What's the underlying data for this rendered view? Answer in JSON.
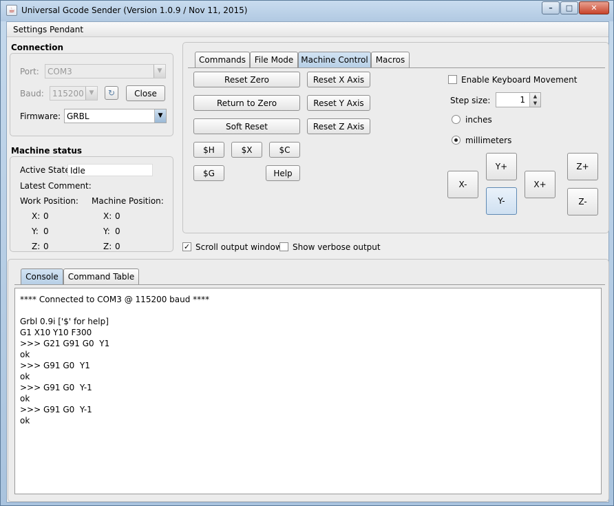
{
  "window": {
    "title": "Universal Gcode Sender (Version 1.0.9 / Nov 11, 2015)",
    "buttons": {
      "minimize": "–",
      "maximize": "□",
      "close": "✕"
    }
  },
  "menu": {
    "items": [
      "Settings",
      "Pendant"
    ]
  },
  "connection": {
    "section_title": "Connection",
    "port_label": "Port:",
    "port_value": "COM3",
    "baud_label": "Baud:",
    "baud_value": "115200",
    "close_button": "Close",
    "firmware_label": "Firmware:",
    "firmware_value": "GRBL"
  },
  "machine_status": {
    "section_title": "Machine status",
    "active_state_label": "Active State:",
    "active_state_value": "Idle",
    "latest_comment_label": "Latest Comment:",
    "work_position_label": "Work Position:",
    "machine_position_label": "Machine Position:",
    "work": {
      "x_label": "X:",
      "x": "0",
      "y_label": "Y:",
      "y": "0",
      "z_label": "Z:",
      "z": "0"
    },
    "machine": {
      "x_label": "X:",
      "x": "0",
      "y_label": "Y:",
      "y": "0",
      "z_label": "Z:",
      "z": "0"
    }
  },
  "control_tabs": {
    "tabs": [
      "Commands",
      "File Mode",
      "Machine Control",
      "Macros"
    ],
    "selected": "Machine Control"
  },
  "machine_control": {
    "reset_zero": "Reset Zero",
    "return_to_zero": "Return to Zero",
    "soft_reset": "Soft Reset",
    "reset_x_axis": "Reset X Axis",
    "reset_y_axis": "Reset Y Axis",
    "reset_z_axis": "Reset Z Axis",
    "cmd_h": "$H",
    "cmd_x": "$X",
    "cmd_c": "$C",
    "cmd_g": "$G",
    "help": "Help",
    "enable_keyboard_movement": "Enable Keyboard Movement",
    "enable_keyboard_checked": false,
    "step_size_label": "Step size:",
    "step_size_value": "1",
    "unit_inches": "inches",
    "unit_millimeters": "millimeters",
    "selected_unit": "millimeters",
    "jog": {
      "x_minus": "X-",
      "x_plus": "X+",
      "y_plus": "Y+",
      "y_minus": "Y-",
      "z_plus": "Z+",
      "z_minus": "Z-"
    }
  },
  "options": {
    "scroll_output": "Scroll output window",
    "scroll_output_checked": true,
    "show_verbose": "Show verbose output",
    "show_verbose_checked": false
  },
  "output_tabs": {
    "tabs": [
      "Console",
      "Command Table"
    ],
    "selected": "Console"
  },
  "console": {
    "lines": [
      "**** Connected to COM3 @ 115200 baud ****",
      "",
      "Grbl 0.9i ['$' for help]",
      "G1 X10 Y10 F300",
      ">>> G21 G91 G0  Y1",
      "ok",
      ">>> G91 G0  Y1",
      "ok",
      ">>> G91 G0  Y-1",
      "ok",
      ">>> G91 G0  Y-1",
      "ok"
    ]
  }
}
